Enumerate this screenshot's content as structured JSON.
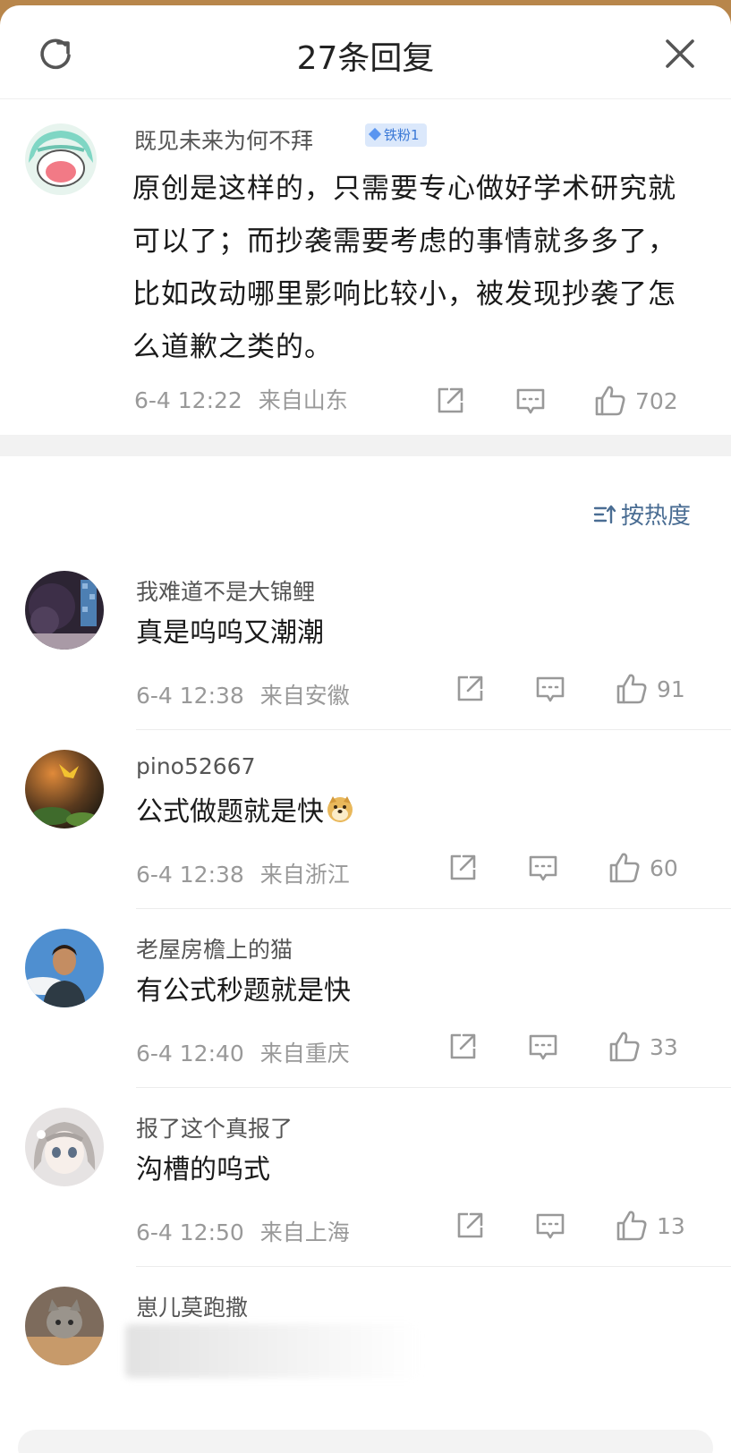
{
  "header": {
    "title": "27条回复",
    "refresh_icon": "refresh-icon",
    "close_icon": "close-icon"
  },
  "main_comment": {
    "username": "既见未来为何不拜",
    "badge": "铁粉1",
    "text": "原创是这样的，只需要专心做好学术研究就可以了；而抄袭需要考虑的事情就多多了，比如改动哪里影响比较小，被发现抄袭了怎么道歉之类的。",
    "date": "6-4 12:22",
    "location": "来自山东",
    "likes": "702"
  },
  "sort": {
    "label": "按热度",
    "icon": "sort-icon"
  },
  "replies": [
    {
      "username": "我难道不是大锦鲤",
      "text": "真是呜呜又潮潮",
      "date": "6-4 12:38",
      "location": "来自安徽",
      "likes": "91"
    },
    {
      "username": "pino52667",
      "text": "公式做题就是快",
      "emoji": "doge-emoji",
      "date": "6-4 12:38",
      "location": "来自浙江",
      "likes": "60"
    },
    {
      "username": "老屋房檐上的猫",
      "text": "有公式秒题就是快",
      "date": "6-4 12:40",
      "location": "来自重庆",
      "likes": "33"
    },
    {
      "username": "报了这个真报了",
      "text": "沟槽的呜式",
      "date": "6-4 12:50",
      "location": "来自上海",
      "likes": "13"
    },
    {
      "username": "崽儿莫跑撒"
    }
  ],
  "colors": {
    "background_top": "#b8864b",
    "meta_gray": "#999999",
    "sort_blue": "#4a6d93",
    "badge_bg": "#dbe8fb",
    "badge_text": "#3a78d6"
  }
}
